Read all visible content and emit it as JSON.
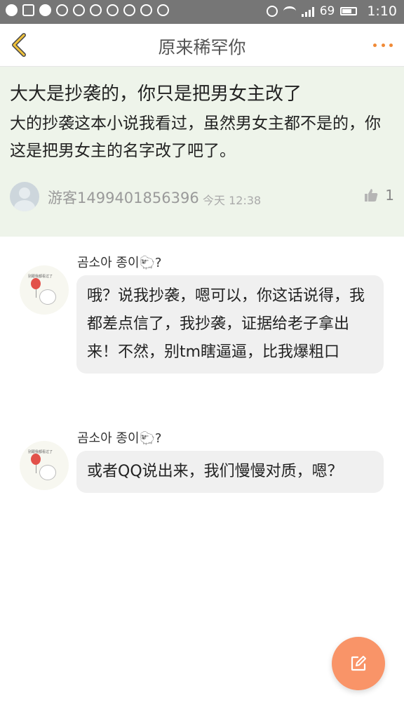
{
  "status_bar": {
    "battery_level": "69",
    "battery_fraction": 0.69,
    "time": "1:10",
    "left_icons": [
      "snapchat-icon",
      "message-icon",
      "upload-icon",
      "sync-icon",
      "weibo-icon",
      "qq-icon",
      "cloud-icon",
      "chat-bubble-icon",
      "heart-icon",
      "more-apps-icon"
    ]
  },
  "header": {
    "title": "原来稀罕你",
    "back_icon": "chevron-left-icon",
    "more_icon": "more-dots-icon",
    "accent_color": "#f0a030"
  },
  "post": {
    "title": "大大是抄袭的，你只是把男女主改了",
    "body": "大的抄袭这本小说我看过，虽然男女主都不是的，你这是把男女主的名字改了吧了。",
    "author": "游客1499401856396",
    "time": "今天 12:38",
    "likes": "1",
    "background": "#eef4ea"
  },
  "replies": [
    {
      "name": "곰소아 종이🐑?",
      "avatar_caption": "别跟我都看过了",
      "text": "哦？说我抄袭，嗯可以，你这话说得，我都差点信了，我抄袭，证据给老子拿出来！不然，别tm瞎逼逼，比我爆粗口"
    },
    {
      "name": "곰소아 종이🐑?",
      "avatar_caption": "别跟我都看过了",
      "text": "或者QQ说出来，我们慢慢对质，嗯？"
    }
  ],
  "fab": {
    "icon": "compose-icon",
    "color": "#f99468"
  }
}
